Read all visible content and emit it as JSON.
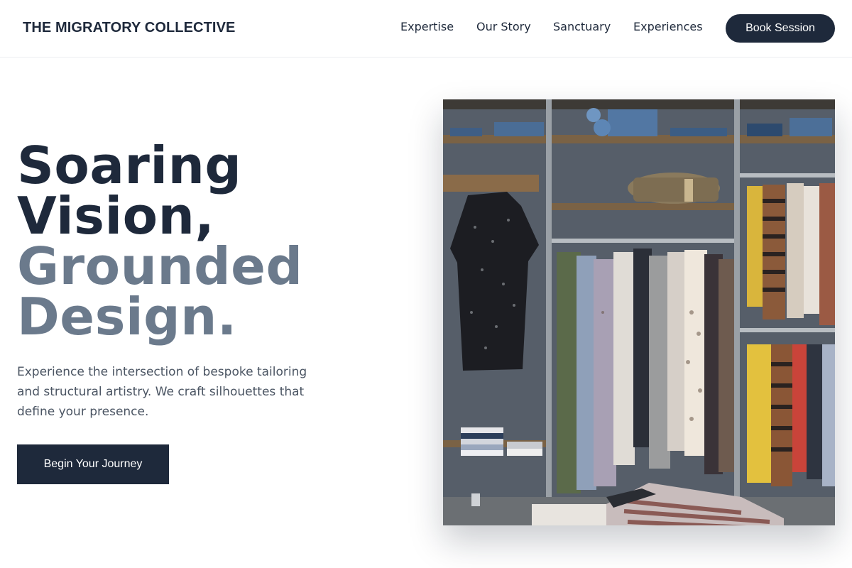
{
  "header": {
    "brand": "THE MIGRATORY COLLECTIVE",
    "nav": [
      {
        "label": "Expertise"
      },
      {
        "label": "Our Story"
      },
      {
        "label": "Sanctuary"
      },
      {
        "label": "Experiences"
      }
    ],
    "cta_label": "Book Session"
  },
  "hero": {
    "title_line1": "Soaring",
    "title_line2": "Vision,",
    "title_line3": "Grounded",
    "title_line4": "Design.",
    "description": "Experience the intersection of bespoke tailoring and structural artistry. We craft silhouettes that define your presence.",
    "cta_label": "Begin Your Journey",
    "image_subject": "clothing-rack-photo"
  },
  "colors": {
    "primary": "#1e293b",
    "muted_heading": "#6b7a8c",
    "body_text": "#4b5563"
  }
}
